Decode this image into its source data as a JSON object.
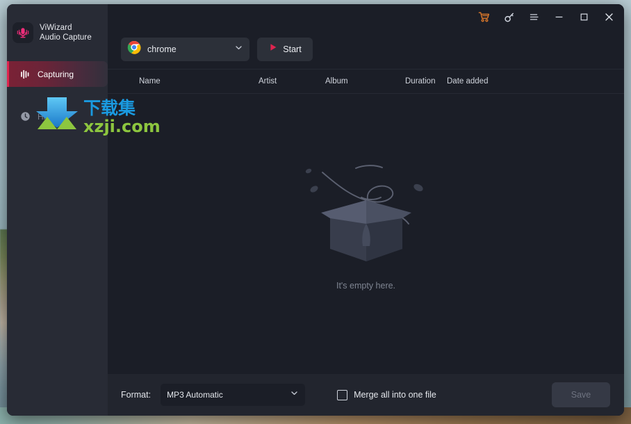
{
  "window": {
    "titlebar_buttons": [
      {
        "name": "cart-icon",
        "label": "Shop"
      },
      {
        "name": "key-icon",
        "label": "Register"
      },
      {
        "name": "menu-icon",
        "label": "Menu"
      },
      {
        "name": "minimize-icon",
        "label": "Minimize"
      },
      {
        "name": "maximize-icon",
        "label": "Maximize"
      },
      {
        "name": "close-icon",
        "label": "Close"
      }
    ]
  },
  "sidebar": {
    "brand": {
      "line1": "ViWizard",
      "line2": "Audio Capture",
      "logo_icon": "microphone-icon"
    },
    "items": [
      {
        "label": "Capturing",
        "icon": "audio-wave-icon",
        "active": true
      },
      {
        "label": "History",
        "icon": "clock-icon",
        "active": false
      }
    ]
  },
  "watermark": {
    "cn_text": "下载集",
    "domain": "xzji.com"
  },
  "toolbar": {
    "source": {
      "value": "chrome",
      "icon": "chrome-icon",
      "chevron": "chevron-down-icon"
    },
    "start": {
      "label": "Start",
      "icon": "play-icon"
    }
  },
  "table": {
    "columns": [
      {
        "key": "name",
        "label": "Name"
      },
      {
        "key": "artist",
        "label": "Artist"
      },
      {
        "key": "album",
        "label": "Album"
      },
      {
        "key": "duration",
        "label": "Duration"
      },
      {
        "key": "date",
        "label": "Date added"
      }
    ],
    "rows": []
  },
  "empty_state": {
    "text": "It's empty here.",
    "illustration": "empty-box-illustration"
  },
  "bottom_bar": {
    "format_label": "Format:",
    "format_value": "MP3 Automatic",
    "merge_label": "Merge all into one file",
    "merge_checked": false,
    "save_label": "Save",
    "save_enabled": false
  },
  "colors": {
    "accent": "#e0244f",
    "sidebar_bg": "#282b35",
    "main_bg": "#1b1e27",
    "bottom_bg": "#22252e",
    "cart_icon": "#e07a2a"
  }
}
